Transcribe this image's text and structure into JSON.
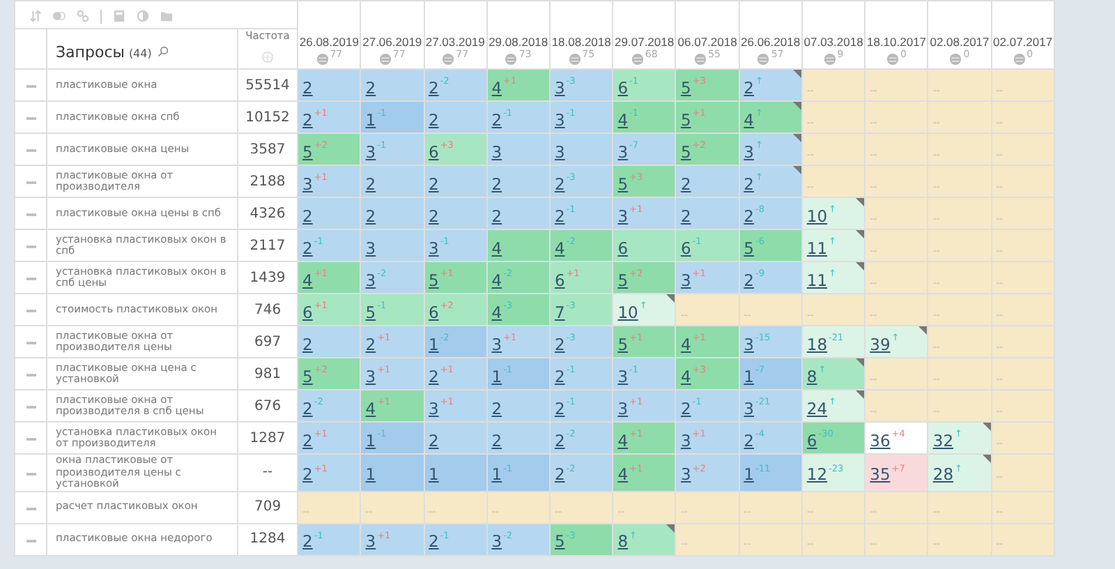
{
  "header": {
    "title": "Запросы",
    "count": "(44)",
    "frequency": "Частота"
  },
  "dates": [
    {
      "date": "26.08.2019",
      "count": "77"
    },
    {
      "date": "27.06.2019",
      "count": "77"
    },
    {
      "date": "27.03.2019",
      "count": "77"
    },
    {
      "date": "29.08.2018",
      "count": "73"
    },
    {
      "date": "18.08.2018",
      "count": "75"
    },
    {
      "date": "29.07.2018",
      "count": "68"
    },
    {
      "date": "06.07.2018",
      "count": "55"
    },
    {
      "date": "26.06.2018",
      "count": "57"
    },
    {
      "date": "07.03.2018",
      "count": "9"
    },
    {
      "date": "18.10.2017",
      "count": "0"
    },
    {
      "date": "02.08.2017",
      "count": "0"
    },
    {
      "date": "02.07.2017",
      "count": "0"
    }
  ],
  "rows": [
    {
      "query": "пластиковые окна",
      "frequency": "55514",
      "cells": [
        {
          "value": "2",
          "kind": "rank",
          "color": "#b5d7f0",
          "flag": false
        },
        {
          "value": "2",
          "kind": "rank",
          "color": "#b5d7f0",
          "flag": false
        },
        {
          "value": "2",
          "change": {
            "text": "-2",
            "color": "#3fbfc6"
          },
          "kind": "rank",
          "color": "#b5d7f0",
          "flag": false
        },
        {
          "value": "4",
          "change": {
            "text": "+1",
            "color": "#ee7d7d"
          },
          "kind": "rank",
          "color": "#8edcaa",
          "flag": false
        },
        {
          "value": "3",
          "change": {
            "text": "-3",
            "color": "#3fbfc6"
          },
          "kind": "rank",
          "color": "#b5d7f0",
          "flag": false
        },
        {
          "value": "6",
          "change": {
            "text": "-1",
            "color": "#3fbfc6"
          },
          "kind": "rank",
          "color": "#a6e6c1",
          "flag": false
        },
        {
          "value": "5",
          "change": {
            "text": "+3",
            "color": "#ee7d7d"
          },
          "kind": "rank",
          "color": "#8edcaa",
          "flag": false
        },
        {
          "value": "2",
          "change": {
            "text": "↑",
            "color": "#3fbfc6"
          },
          "kind": "rank",
          "color": "#b5d7f0",
          "flag": true
        },
        {
          "value": "--",
          "kind": "none",
          "color": "#f7e8c6",
          "flag": false
        },
        {
          "value": "--",
          "kind": "none",
          "color": "#f7e8c6",
          "flag": false
        },
        {
          "value": "--",
          "kind": "none",
          "color": "#f7e8c6",
          "flag": false
        },
        {
          "value": "--",
          "kind": "none",
          "color": "#f7e8c6",
          "flag": false
        }
      ]
    },
    {
      "query": "пластиковые окна спб",
      "frequency": "10152",
      "cells": [
        {
          "value": "2",
          "change": {
            "text": "+1",
            "color": "#ee7d7d"
          },
          "kind": "rank",
          "color": "#b5d7f0",
          "flag": false
        },
        {
          "value": "1",
          "change": {
            "text": "-1",
            "color": "#3fbfc6"
          },
          "kind": "rank",
          "color": "#a3cbec",
          "flag": false
        },
        {
          "value": "2",
          "kind": "rank",
          "color": "#b5d7f0",
          "flag": false
        },
        {
          "value": "2",
          "change": {
            "text": "-1",
            "color": "#3fbfc6"
          },
          "kind": "rank",
          "color": "#b5d7f0",
          "flag": false
        },
        {
          "value": "3",
          "change": {
            "text": "-1",
            "color": "#3fbfc6"
          },
          "kind": "rank",
          "color": "#b5d7f0",
          "flag": false
        },
        {
          "value": "4",
          "change": {
            "text": "-1",
            "color": "#3fbfc6"
          },
          "kind": "rank",
          "color": "#8edcaa",
          "flag": false
        },
        {
          "value": "5",
          "change": {
            "text": "+1",
            "color": "#ee7d7d"
          },
          "kind": "rank",
          "color": "#8edcaa",
          "flag": false
        },
        {
          "value": "4",
          "change": {
            "text": "↑",
            "color": "#3fbfc6"
          },
          "kind": "rank",
          "color": "#8edcaa",
          "flag": true
        },
        {
          "value": "--",
          "kind": "none",
          "color": "#f7e8c6",
          "flag": false
        },
        {
          "value": "--",
          "kind": "none",
          "color": "#f7e8c6",
          "flag": false
        },
        {
          "value": "--",
          "kind": "none",
          "color": "#f7e8c6",
          "flag": false
        },
        {
          "value": "--",
          "kind": "none",
          "color": "#f7e8c6",
          "flag": false
        }
      ]
    },
    {
      "query": "пластиковые окна цены",
      "frequency": "3587",
      "cells": [
        {
          "value": "5",
          "change": {
            "text": "+2",
            "color": "#ee7d7d"
          },
          "kind": "rank",
          "color": "#8edcaa",
          "flag": false
        },
        {
          "value": "3",
          "change": {
            "text": "-1",
            "color": "#3fbfc6"
          },
          "kind": "rank",
          "color": "#b5d7f0",
          "flag": false
        },
        {
          "value": "6",
          "change": {
            "text": "+3",
            "color": "#ee7d7d"
          },
          "kind": "rank",
          "color": "#a6e6c1",
          "flag": false
        },
        {
          "value": "3",
          "kind": "rank",
          "color": "#b5d7f0",
          "flag": false
        },
        {
          "value": "3",
          "kind": "rank",
          "color": "#b5d7f0",
          "flag": false
        },
        {
          "value": "3",
          "change": {
            "text": "-7",
            "color": "#3fbfc6"
          },
          "kind": "rank",
          "color": "#b5d7f0",
          "flag": false
        },
        {
          "value": "5",
          "change": {
            "text": "+2",
            "color": "#ee7d7d"
          },
          "kind": "rank",
          "color": "#8edcaa",
          "flag": false
        },
        {
          "value": "3",
          "change": {
            "text": "↑",
            "color": "#3fbfc6"
          },
          "kind": "rank",
          "color": "#b5d7f0",
          "flag": true
        },
        {
          "value": "--",
          "kind": "none",
          "color": "#f7e8c6",
          "flag": false
        },
        {
          "value": "--",
          "kind": "none",
          "color": "#f7e8c6",
          "flag": false
        },
        {
          "value": "--",
          "kind": "none",
          "color": "#f7e8c6",
          "flag": false
        },
        {
          "value": "--",
          "kind": "none",
          "color": "#f7e8c6",
          "flag": false
        }
      ]
    },
    {
      "query": "пластиковые окна от производителя",
      "frequency": "2188",
      "cells": [
        {
          "value": "3",
          "change": {
            "text": "+1",
            "color": "#ee7d7d"
          },
          "kind": "rank",
          "color": "#b5d7f0",
          "flag": false
        },
        {
          "value": "2",
          "kind": "rank",
          "color": "#b5d7f0",
          "flag": false
        },
        {
          "value": "2",
          "kind": "rank",
          "color": "#b5d7f0",
          "flag": false
        },
        {
          "value": "2",
          "kind": "rank",
          "color": "#b5d7f0",
          "flag": false
        },
        {
          "value": "2",
          "change": {
            "text": "-3",
            "color": "#3fbfc6"
          },
          "kind": "rank",
          "color": "#b5d7f0",
          "flag": false
        },
        {
          "value": "5",
          "change": {
            "text": "+3",
            "color": "#ee7d7d"
          },
          "kind": "rank",
          "color": "#8edcaa",
          "flag": false
        },
        {
          "value": "2",
          "kind": "rank",
          "color": "#b5d7f0",
          "flag": false
        },
        {
          "value": "2",
          "change": {
            "text": "↑",
            "color": "#3fbfc6"
          },
          "kind": "rank",
          "color": "#b5d7f0",
          "flag": true
        },
        {
          "value": "--",
          "kind": "none",
          "color": "#f7e8c6",
          "flag": false
        },
        {
          "value": "--",
          "kind": "none",
          "color": "#f7e8c6",
          "flag": false
        },
        {
          "value": "--",
          "kind": "none",
          "color": "#f7e8c6",
          "flag": false
        },
        {
          "value": "--",
          "kind": "none",
          "color": "#f7e8c6",
          "flag": false
        }
      ]
    },
    {
      "query": "пластиковые окна цены в спб",
      "frequency": "4326",
      "cells": [
        {
          "value": "2",
          "kind": "rank",
          "color": "#b5d7f0",
          "flag": false
        },
        {
          "value": "2",
          "kind": "rank",
          "color": "#b5d7f0",
          "flag": false
        },
        {
          "value": "2",
          "kind": "rank",
          "color": "#b5d7f0",
          "flag": false
        },
        {
          "value": "2",
          "kind": "rank",
          "color": "#b5d7f0",
          "flag": false
        },
        {
          "value": "2",
          "change": {
            "text": "-1",
            "color": "#3fbfc6"
          },
          "kind": "rank",
          "color": "#b5d7f0",
          "flag": false
        },
        {
          "value": "3",
          "change": {
            "text": "+1",
            "color": "#ee7d7d"
          },
          "kind": "rank",
          "color": "#b5d7f0",
          "flag": false
        },
        {
          "value": "2",
          "kind": "rank",
          "color": "#b5d7f0",
          "flag": false
        },
        {
          "value": "2",
          "change": {
            "text": "-8",
            "color": "#3fbfc6"
          },
          "kind": "rank",
          "color": "#b5d7f0",
          "flag": false
        },
        {
          "value": "10",
          "change": {
            "text": "↑",
            "color": "#3fbfc6"
          },
          "kind": "rank",
          "color": "#dcf4e6",
          "flag": true
        },
        {
          "value": "--",
          "kind": "none",
          "color": "#f7e8c6",
          "flag": false
        },
        {
          "value": "--",
          "kind": "none",
          "color": "#f7e8c6",
          "flag": false
        },
        {
          "value": "--",
          "kind": "none",
          "color": "#f7e8c6",
          "flag": false
        }
      ]
    },
    {
      "query": "установка пластиковых окон в спб",
      "frequency": "2117",
      "cells": [
        {
          "value": "2",
          "change": {
            "text": "-1",
            "color": "#3fbfc6"
          },
          "kind": "rank",
          "color": "#b5d7f0",
          "flag": false
        },
        {
          "value": "3",
          "kind": "rank",
          "color": "#b5d7f0",
          "flag": false
        },
        {
          "value": "3",
          "change": {
            "text": "-1",
            "color": "#3fbfc6"
          },
          "kind": "rank",
          "color": "#b5d7f0",
          "flag": false
        },
        {
          "value": "4",
          "kind": "rank",
          "color": "#8edcaa",
          "flag": false
        },
        {
          "value": "4",
          "change": {
            "text": "-2",
            "color": "#3fbfc6"
          },
          "kind": "rank",
          "color": "#8edcaa",
          "flag": false
        },
        {
          "value": "6",
          "kind": "rank",
          "color": "#a6e6c1",
          "flag": false
        },
        {
          "value": "6",
          "change": {
            "text": "-1",
            "color": "#3fbfc6"
          },
          "kind": "rank",
          "color": "#a6e6c1",
          "flag": false
        },
        {
          "value": "5",
          "change": {
            "text": "-6",
            "color": "#3fbfc6"
          },
          "kind": "rank",
          "color": "#8edcaa",
          "flag": false
        },
        {
          "value": "11",
          "change": {
            "text": "↑",
            "color": "#3fbfc6"
          },
          "kind": "rank",
          "color": "#dcf4e6",
          "flag": true
        },
        {
          "value": "--",
          "kind": "none",
          "color": "#f7e8c6",
          "flag": false
        },
        {
          "value": "--",
          "kind": "none",
          "color": "#f7e8c6",
          "flag": false
        },
        {
          "value": "--",
          "kind": "none",
          "color": "#f7e8c6",
          "flag": false
        }
      ]
    },
    {
      "query": "установка пластиковых окон в спб цены",
      "frequency": "1439",
      "cells": [
        {
          "value": "4",
          "change": {
            "text": "+1",
            "color": "#ee7d7d"
          },
          "kind": "rank",
          "color": "#8edcaa",
          "flag": false
        },
        {
          "value": "3",
          "change": {
            "text": "-2",
            "color": "#3fbfc6"
          },
          "kind": "rank",
          "color": "#b5d7f0",
          "flag": false
        },
        {
          "value": "5",
          "change": {
            "text": "+1",
            "color": "#ee7d7d"
          },
          "kind": "rank",
          "color": "#8edcaa",
          "flag": false
        },
        {
          "value": "4",
          "change": {
            "text": "-2",
            "color": "#3fbfc6"
          },
          "kind": "rank",
          "color": "#8edcaa",
          "flag": false
        },
        {
          "value": "6",
          "change": {
            "text": "+1",
            "color": "#ee7d7d"
          },
          "kind": "rank",
          "color": "#a6e6c1",
          "flag": false
        },
        {
          "value": "5",
          "change": {
            "text": "+2",
            "color": "#ee7d7d"
          },
          "kind": "rank",
          "color": "#8edcaa",
          "flag": false
        },
        {
          "value": "3",
          "change": {
            "text": "+1",
            "color": "#ee7d7d"
          },
          "kind": "rank",
          "color": "#b5d7f0",
          "flag": false
        },
        {
          "value": "2",
          "change": {
            "text": "-9",
            "color": "#3fbfc6"
          },
          "kind": "rank",
          "color": "#b5d7f0",
          "flag": false
        },
        {
          "value": "11",
          "change": {
            "text": "↑",
            "color": "#3fbfc6"
          },
          "kind": "rank",
          "color": "#dcf4e6",
          "flag": true
        },
        {
          "value": "--",
          "kind": "none",
          "color": "#f7e8c6",
          "flag": false
        },
        {
          "value": "--",
          "kind": "none",
          "color": "#f7e8c6",
          "flag": false
        },
        {
          "value": "--",
          "kind": "none",
          "color": "#f7e8c6",
          "flag": false
        }
      ]
    },
    {
      "query": "стоимость пластиковых окон",
      "frequency": "746",
      "cells": [
        {
          "value": "6",
          "change": {
            "text": "+1",
            "color": "#ee7d7d"
          },
          "kind": "rank",
          "color": "#a6e6c1",
          "flag": false
        },
        {
          "value": "5",
          "change": {
            "text": "-1",
            "color": "#3fbfc6"
          },
          "kind": "rank",
          "color": "#a6e6c1",
          "flag": false
        },
        {
          "value": "6",
          "change": {
            "text": "+2",
            "color": "#ee7d7d"
          },
          "kind": "rank",
          "color": "#a6e6c1",
          "flag": false
        },
        {
          "value": "4",
          "change": {
            "text": "-3",
            "color": "#3fbfc6"
          },
          "kind": "rank",
          "color": "#8edcaa",
          "flag": false
        },
        {
          "value": "7",
          "change": {
            "text": "-3",
            "color": "#3fbfc6"
          },
          "kind": "rank",
          "color": "#a6e6c1",
          "flag": false
        },
        {
          "value": "10",
          "change": {
            "text": "↑",
            "color": "#3fbfc6"
          },
          "kind": "rank",
          "color": "#dcf4e6",
          "flag": true
        },
        {
          "value": "--",
          "kind": "none",
          "color": "#f7e8c6",
          "flag": false
        },
        {
          "value": "--",
          "kind": "none",
          "color": "#f7e8c6",
          "flag": false
        },
        {
          "value": "--",
          "kind": "none",
          "color": "#f7e8c6",
          "flag": false
        },
        {
          "value": "--",
          "kind": "none",
          "color": "#f7e8c6",
          "flag": false
        },
        {
          "value": "--",
          "kind": "none",
          "color": "#f7e8c6",
          "flag": false
        },
        {
          "value": "--",
          "kind": "none",
          "color": "#f7e8c6",
          "flag": false
        }
      ]
    },
    {
      "query": "пластиковые окна от производителя цены",
      "frequency": "697",
      "cells": [
        {
          "value": "2",
          "kind": "rank",
          "color": "#b5d7f0",
          "flag": false
        },
        {
          "value": "2",
          "change": {
            "text": "+1",
            "color": "#ee7d7d"
          },
          "kind": "rank",
          "color": "#b5d7f0",
          "flag": false
        },
        {
          "value": "1",
          "change": {
            "text": "-2",
            "color": "#3fbfc6"
          },
          "kind": "rank",
          "color": "#a3cbec",
          "flag": false
        },
        {
          "value": "3",
          "change": {
            "text": "+1",
            "color": "#ee7d7d"
          },
          "kind": "rank",
          "color": "#b5d7f0",
          "flag": false
        },
        {
          "value": "2",
          "change": {
            "text": "-3",
            "color": "#3fbfc6"
          },
          "kind": "rank",
          "color": "#b5d7f0",
          "flag": false
        },
        {
          "value": "5",
          "change": {
            "text": "+1",
            "color": "#ee7d7d"
          },
          "kind": "rank",
          "color": "#8edcaa",
          "flag": false
        },
        {
          "value": "4",
          "change": {
            "text": "+1",
            "color": "#ee7d7d"
          },
          "kind": "rank",
          "color": "#8edcaa",
          "flag": false
        },
        {
          "value": "3",
          "change": {
            "text": "-15",
            "color": "#3fbfc6"
          },
          "kind": "rank",
          "color": "#b5d7f0",
          "flag": false
        },
        {
          "value": "18",
          "change": {
            "text": "-21",
            "color": "#3fbfc6"
          },
          "kind": "rank",
          "color": "#dcf4e6",
          "flag": false
        },
        {
          "value": "39",
          "change": {
            "text": "↑",
            "color": "#3fbfc6"
          },
          "kind": "rank",
          "color": "#dcf4e6",
          "flag": true
        },
        {
          "value": "--",
          "kind": "none",
          "color": "#f7e8c6",
          "flag": false
        },
        {
          "value": "--",
          "kind": "none",
          "color": "#f7e8c6",
          "flag": false
        }
      ]
    },
    {
      "query": "пластиковые окна цена с установкой",
      "frequency": "981",
      "cells": [
        {
          "value": "5",
          "change": {
            "text": "+2",
            "color": "#ee7d7d"
          },
          "kind": "rank",
          "color": "#8edcaa",
          "flag": false
        },
        {
          "value": "3",
          "change": {
            "text": "+1",
            "color": "#ee7d7d"
          },
          "kind": "rank",
          "color": "#b5d7f0",
          "flag": false
        },
        {
          "value": "2",
          "change": {
            "text": "+1",
            "color": "#ee7d7d"
          },
          "kind": "rank",
          "color": "#b5d7f0",
          "flag": false
        },
        {
          "value": "1",
          "change": {
            "text": "-1",
            "color": "#3fbfc6"
          },
          "kind": "rank",
          "color": "#a3cbec",
          "flag": false
        },
        {
          "value": "2",
          "change": {
            "text": "-1",
            "color": "#3fbfc6"
          },
          "kind": "rank",
          "color": "#b5d7f0",
          "flag": false
        },
        {
          "value": "3",
          "change": {
            "text": "-1",
            "color": "#3fbfc6"
          },
          "kind": "rank",
          "color": "#b5d7f0",
          "flag": false
        },
        {
          "value": "4",
          "change": {
            "text": "+3",
            "color": "#ee7d7d"
          },
          "kind": "rank",
          "color": "#8edcaa",
          "flag": false
        },
        {
          "value": "1",
          "change": {
            "text": "-7",
            "color": "#3fbfc6"
          },
          "kind": "rank",
          "color": "#a3cbec",
          "flag": false
        },
        {
          "value": "8",
          "change": {
            "text": "↑",
            "color": "#3fbfc6"
          },
          "kind": "rank",
          "color": "#a6e6c1",
          "flag": true
        },
        {
          "value": "--",
          "kind": "none",
          "color": "#f7e8c6",
          "flag": false
        },
        {
          "value": "--",
          "kind": "none",
          "color": "#f7e8c6",
          "flag": false
        },
        {
          "value": "--",
          "kind": "none",
          "color": "#f7e8c6",
          "flag": false
        }
      ]
    },
    {
      "query": "пластиковые окна от производителя в спб цены",
      "frequency": "676",
      "cells": [
        {
          "value": "2",
          "change": {
            "text": "-2",
            "color": "#3fbfc6"
          },
          "kind": "rank",
          "color": "#b5d7f0",
          "flag": false
        },
        {
          "value": "4",
          "change": {
            "text": "+1",
            "color": "#ee7d7d"
          },
          "kind": "rank",
          "color": "#8edcaa",
          "flag": false
        },
        {
          "value": "3",
          "change": {
            "text": "+1",
            "color": "#ee7d7d"
          },
          "kind": "rank",
          "color": "#b5d7f0",
          "flag": false
        },
        {
          "value": "2",
          "kind": "rank",
          "color": "#b5d7f0",
          "flag": false
        },
        {
          "value": "2",
          "change": {
            "text": "-1",
            "color": "#3fbfc6"
          },
          "kind": "rank",
          "color": "#b5d7f0",
          "flag": false
        },
        {
          "value": "3",
          "change": {
            "text": "+1",
            "color": "#ee7d7d"
          },
          "kind": "rank",
          "color": "#b5d7f0",
          "flag": false
        },
        {
          "value": "2",
          "change": {
            "text": "-1",
            "color": "#3fbfc6"
          },
          "kind": "rank",
          "color": "#b5d7f0",
          "flag": false
        },
        {
          "value": "3",
          "change": {
            "text": "-21",
            "color": "#3fbfc6"
          },
          "kind": "rank",
          "color": "#b5d7f0",
          "flag": false
        },
        {
          "value": "24",
          "change": {
            "text": "↑",
            "color": "#3fbfc6"
          },
          "kind": "rank",
          "color": "#dcf4e6",
          "flag": true
        },
        {
          "value": "--",
          "kind": "none",
          "color": "#f7e8c6",
          "flag": false
        },
        {
          "value": "--",
          "kind": "none",
          "color": "#f7e8c6",
          "flag": false
        },
        {
          "value": "--",
          "kind": "none",
          "color": "#f7e8c6",
          "flag": false
        }
      ]
    },
    {
      "query": "установка пластиковых окон от производителя",
      "frequency": "1287",
      "cells": [
        {
          "value": "2",
          "change": {
            "text": "+1",
            "color": "#ee7d7d"
          },
          "kind": "rank",
          "color": "#b5d7f0",
          "flag": false
        },
        {
          "value": "1",
          "change": {
            "text": "-1",
            "color": "#3fbfc6"
          },
          "kind": "rank",
          "color": "#a3cbec",
          "flag": false
        },
        {
          "value": "2",
          "kind": "rank",
          "color": "#b5d7f0",
          "flag": false
        },
        {
          "value": "2",
          "kind": "rank",
          "color": "#b5d7f0",
          "flag": false
        },
        {
          "value": "2",
          "change": {
            "text": "-2",
            "color": "#3fbfc6"
          },
          "kind": "rank",
          "color": "#b5d7f0",
          "flag": false
        },
        {
          "value": "4",
          "change": {
            "text": "+1",
            "color": "#ee7d7d"
          },
          "kind": "rank",
          "color": "#8edcaa",
          "flag": false
        },
        {
          "value": "3",
          "change": {
            "text": "+1",
            "color": "#ee7d7d"
          },
          "kind": "rank",
          "color": "#b5d7f0",
          "flag": false
        },
        {
          "value": "2",
          "change": {
            "text": "-4",
            "color": "#3fbfc6"
          },
          "kind": "rank",
          "color": "#b5d7f0",
          "flag": false
        },
        {
          "value": "6",
          "change": {
            "text": "-30",
            "color": "#3fbfc6"
          },
          "kind": "rank",
          "color": "#8edcaa",
          "flag": false
        },
        {
          "value": "36",
          "change": {
            "text": "+4",
            "color": "#ee7d7d"
          },
          "kind": "rank",
          "color": "#ffffff",
          "flag": false
        },
        {
          "value": "32",
          "change": {
            "text": "↑",
            "color": "#3fbfc6"
          },
          "kind": "rank",
          "color": "#dcf4e6",
          "flag": true
        },
        {
          "value": "--",
          "kind": "none",
          "color": "#f7e8c6",
          "flag": false
        }
      ]
    },
    {
      "query": "окна пластиковые от производителя цены с установкой",
      "frequency": "--",
      "cells": [
        {
          "value": "2",
          "change": {
            "text": "+1",
            "color": "#ee7d7d"
          },
          "kind": "rank",
          "color": "#b5d7f0",
          "flag": false
        },
        {
          "value": "1",
          "kind": "rank",
          "color": "#a3cbec",
          "flag": false
        },
        {
          "value": "1",
          "kind": "rank",
          "color": "#a3cbec",
          "flag": false
        },
        {
          "value": "1",
          "change": {
            "text": "-1",
            "color": "#3fbfc6"
          },
          "kind": "rank",
          "color": "#a3cbec",
          "flag": false
        },
        {
          "value": "2",
          "change": {
            "text": "-2",
            "color": "#3fbfc6"
          },
          "kind": "rank",
          "color": "#b5d7f0",
          "flag": false
        },
        {
          "value": "4",
          "change": {
            "text": "+1",
            "color": "#ee7d7d"
          },
          "kind": "rank",
          "color": "#8edcaa",
          "flag": false
        },
        {
          "value": "3",
          "change": {
            "text": "+2",
            "color": "#ee7d7d"
          },
          "kind": "rank",
          "color": "#b5d7f0",
          "flag": false
        },
        {
          "value": "1",
          "change": {
            "text": "-11",
            "color": "#3fbfc6"
          },
          "kind": "rank",
          "color": "#a3cbec",
          "flag": false
        },
        {
          "value": "12",
          "change": {
            "text": "-23",
            "color": "#3fbfc6"
          },
          "kind": "rank",
          "color": "#dcf4e6",
          "flag": false
        },
        {
          "value": "35",
          "change": {
            "text": "+7",
            "color": "#ee7d7d"
          },
          "kind": "rank",
          "color": "#f9dadc",
          "flag": false
        },
        {
          "value": "28",
          "change": {
            "text": "↑",
            "color": "#3fbfc6"
          },
          "kind": "rank",
          "color": "#dcf4e6",
          "flag": true
        },
        {
          "value": "--",
          "kind": "none",
          "color": "#f7e8c6",
          "flag": false
        }
      ]
    },
    {
      "query": "расчет пластиковых окон",
      "frequency": "709",
      "cells": [
        {
          "value": "--",
          "kind": "none",
          "color": "#f7e8c6",
          "flag": false
        },
        {
          "value": "--",
          "kind": "none",
          "color": "#f7e8c6",
          "flag": false
        },
        {
          "value": "--",
          "kind": "none",
          "color": "#f7e8c6",
          "flag": false
        },
        {
          "value": "--",
          "kind": "none",
          "color": "#f7e8c6",
          "flag": false
        },
        {
          "value": "--",
          "kind": "none",
          "color": "#f7e8c6",
          "flag": false
        },
        {
          "value": "--",
          "kind": "none",
          "color": "#f7e8c6",
          "flag": false
        },
        {
          "value": "--",
          "kind": "none",
          "color": "#f7e8c6",
          "flag": false
        },
        {
          "value": "--",
          "kind": "none",
          "color": "#f7e8c6",
          "flag": false
        },
        {
          "value": "--",
          "kind": "none",
          "color": "#f7e8c6",
          "flag": false
        },
        {
          "value": "--",
          "kind": "none",
          "color": "#f7e8c6",
          "flag": false
        },
        {
          "value": "--",
          "kind": "none",
          "color": "#f7e8c6",
          "flag": false
        },
        {
          "value": "--",
          "kind": "none",
          "color": "#f7e8c6",
          "flag": false
        }
      ]
    },
    {
      "query": "пластиковые окна недорого",
      "frequency": "1284",
      "cells": [
        {
          "value": "2",
          "change": {
            "text": "-1",
            "color": "#3fbfc6"
          },
          "kind": "rank",
          "color": "#b5d7f0",
          "flag": false
        },
        {
          "value": "3",
          "change": {
            "text": "+1",
            "color": "#ee7d7d"
          },
          "kind": "rank",
          "color": "#b5d7f0",
          "flag": false
        },
        {
          "value": "2",
          "change": {
            "text": "-1",
            "color": "#3fbfc6"
          },
          "kind": "rank",
          "color": "#b5d7f0",
          "flag": false
        },
        {
          "value": "3",
          "change": {
            "text": "-2",
            "color": "#3fbfc6"
          },
          "kind": "rank",
          "color": "#b5d7f0",
          "flag": false
        },
        {
          "value": "5",
          "change": {
            "text": "-3",
            "color": "#3fbfc6"
          },
          "kind": "rank",
          "color": "#8edcaa",
          "flag": false
        },
        {
          "value": "8",
          "change": {
            "text": "↑",
            "color": "#3fbfc6"
          },
          "kind": "rank",
          "color": "#a6e6c1",
          "flag": true
        },
        {
          "value": "--",
          "kind": "none",
          "color": "#f7e8c6",
          "flag": false
        },
        {
          "value": "--",
          "kind": "none",
          "color": "#f7e8c6",
          "flag": false
        },
        {
          "value": "--",
          "kind": "none",
          "color": "#f7e8c6",
          "flag": false
        },
        {
          "value": "--",
          "kind": "none",
          "color": "#f7e8c6",
          "flag": false
        },
        {
          "value": "--",
          "kind": "none",
          "color": "#f7e8c6",
          "flag": false
        },
        {
          "value": "--",
          "kind": "none",
          "color": "#f7e8c6",
          "flag": false
        }
      ]
    }
  ]
}
